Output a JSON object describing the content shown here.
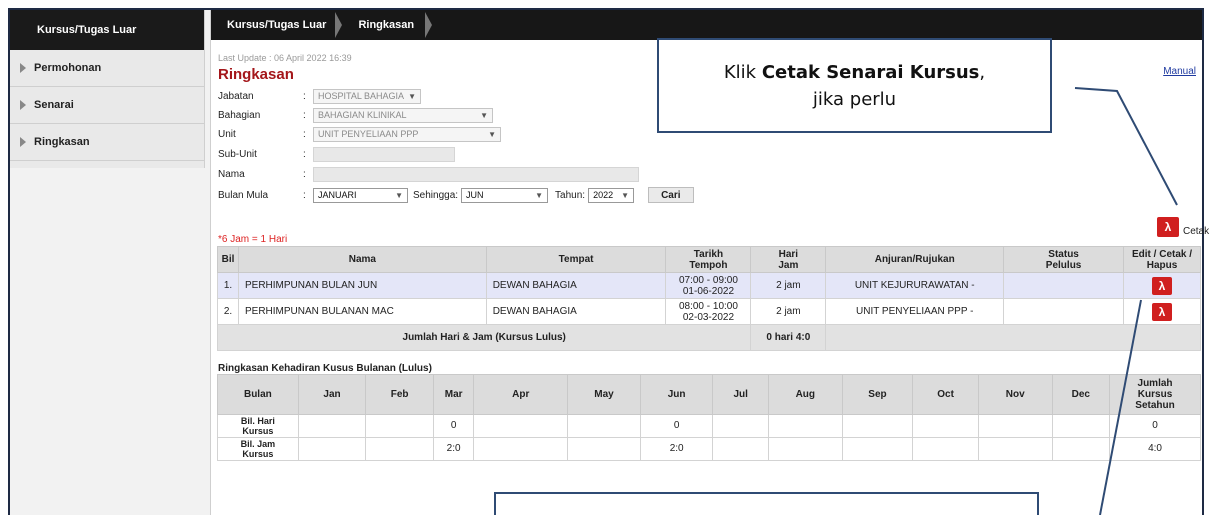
{
  "sidebar": {
    "header": "Kursus/Tugas Luar",
    "items": [
      {
        "label": "Permohonan"
      },
      {
        "label": "Senarai"
      },
      {
        "label": "Ringkasan"
      }
    ]
  },
  "breadcrumb": [
    "Kursus/Tugas Luar",
    "Ringkasan"
  ],
  "page": {
    "last_update": "Last Update : 06 April 2022 16:39",
    "title": "Ringkasan",
    "manual_link": "Manual",
    "note": "*6 Jam = 1 Hari",
    "cetak_label": "Cetak"
  },
  "form": {
    "jabatan": {
      "label": "Jabatan",
      "value": "HOSPITAL BAHAGIA"
    },
    "bahagian": {
      "label": "Bahagian",
      "value": "BAHAGIAN KLINIKAL"
    },
    "unit": {
      "label": "Unit",
      "value": "UNIT PENYELIAAN PPP"
    },
    "subunit": {
      "label": "Sub-Unit",
      "value": ""
    },
    "nama": {
      "label": "Nama",
      "value": ""
    },
    "bulan_mula": {
      "label": "Bulan Mula",
      "value": "JANUARI"
    },
    "sehingga": {
      "label": "Sehingga:",
      "value": "JUN"
    },
    "tahun": {
      "label": "Tahun:",
      "value": "2022"
    },
    "cari_button": "Cari"
  },
  "table": {
    "headers": {
      "bil": "Bil",
      "nama": "Nama",
      "tempat": "Tempat",
      "tarikh_1": "Tarikh",
      "tarikh_2": "Tempoh",
      "hari_1": "Hari",
      "hari_2": "Jam",
      "anjuran": "Anjuran/Rujukan",
      "status_1": "Status",
      "status_2": "Pelulus",
      "edit_1": "Edit / Cetak /",
      "edit_2": "Hapus"
    },
    "rows": [
      {
        "bil": "1.",
        "nama": "PERHIMPUNAN BULAN JUN",
        "tempat": "DEWAN BAHAGIA",
        "masa": "07:00 - 09:00",
        "tarikh": "01-06-2022",
        "hari_jam": "2 jam",
        "anjuran": "UNIT KEJURURAWATAN -",
        "status": ""
      },
      {
        "bil": "2.",
        "nama": "PERHIMPUNAN BULANAN MAC",
        "tempat": "DEWAN BAHAGIA",
        "masa": "08:00 - 10:00",
        "tarikh": "02-03-2022",
        "hari_jam": "2 jam",
        "anjuran": "UNIT PENYELIAAN PPP -",
        "status": ""
      }
    ],
    "summary_label": "Jumlah Hari & Jam (Kursus Lulus)",
    "summary_value": "0 hari 4:0"
  },
  "monthly": {
    "title": "Ringkasan Kehadiran Kusus Bulanan (Lulus)",
    "header_bulan": "Bulan",
    "months": [
      "Jan",
      "Feb",
      "Mar",
      "Apr",
      "May",
      "Jun",
      "Jul",
      "Aug",
      "Sep",
      "Oct",
      "Nov",
      "Dec"
    ],
    "total_header": [
      "Jumlah",
      "Kursus",
      "Setahun"
    ],
    "rows": [
      {
        "label": [
          "Bil. Hari",
          "Kursus"
        ],
        "values": [
          "",
          "",
          "0",
          "",
          "",
          "0",
          "",
          "",
          "",
          "",
          "",
          ""
        ],
        "total": "0"
      },
      {
        "label": [
          "Bil. Jam",
          "Kursus"
        ],
        "values": [
          "",
          "",
          "2:0",
          "",
          "",
          "2:0",
          "",
          "",
          "",
          "",
          "",
          ""
        ],
        "total": "4:0"
      }
    ]
  },
  "callouts": {
    "top_prefix": "Klik ",
    "top_bold": "Cetak Senarai Kursus",
    "top_suffix": ",",
    "top_line2": "jika perlu"
  },
  "colors": {
    "accent_title": "#a4161a",
    "pdf_red": "#d01f1f",
    "highlight_row": "#e4e6f8",
    "callout_border": "#2f4b74"
  }
}
